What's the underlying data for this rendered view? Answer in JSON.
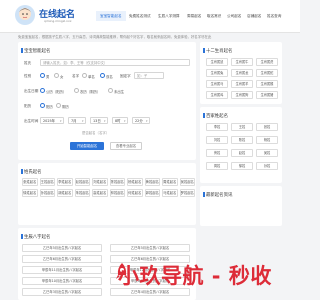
{
  "logo": {
    "title": "在线起名",
    "subtitle": "qiming.mingzi.xxx"
  },
  "nav": [
    {
      "label": "宝宝智能起名",
      "active": true
    },
    {
      "label": "免费姓名测试"
    },
    {
      "label": "生辰八字测算"
    },
    {
      "label": "周易起名"
    },
    {
      "label": "取名常识"
    },
    {
      "label": "公司起名"
    },
    {
      "label": "店铺起名"
    },
    {
      "label": "姓名查询"
    }
  ],
  "notice": "免费宝宝起名，根据孩子生辰八字、五行喜忌、诗词典故智能推荐，帮你起个好名字，取名就来起名网，免费体验，好名字尽在此",
  "form": {
    "title": "宝宝智能起名",
    "surname_label": "姓氏",
    "surname_placeholder": "请输入姓氏，如：李、王等（仅支持中文）",
    "gender_label": "性别",
    "gender_options": [
      "男",
      "女"
    ],
    "name_len_label": "名字",
    "name_len_options": [
      "单名",
      "双名"
    ],
    "fixed_char_label": "固定字",
    "fixed_char_placeholder": "如：子",
    "birth_label": "出生日期",
    "birth_options": [
      "公历（阳历）",
      "农历（阴历）",
      "未出生"
    ],
    "calendar_options": [
      "阳历",
      "阴历"
    ],
    "date_label": "出生时间",
    "year": "2025年",
    "month": "7月",
    "day": "13日",
    "hour": "8时",
    "minute": "22分",
    "hint": "是否起名（名字）",
    "submit": "开始智能起名",
    "secondary": "查看专业起名"
  },
  "right_top": {
    "title": "十二生肖起名",
    "items": [
      "生肖属鼠",
      "生肖属牛",
      "生肖属虎",
      "生肖属兔",
      "生肖属龙",
      "生肖属蛇",
      "生肖属马",
      "生肖属羊",
      "生肖属猴",
      "生肖属鸡",
      "生肖属狗",
      "生肖属猪"
    ]
  },
  "right_mid": {
    "title": "百家姓起名",
    "items": [
      "李姓",
      "王姓",
      "张姓",
      "刘姓",
      "陈姓",
      "杨姓",
      "黄姓",
      "赵姓",
      "吴姓",
      "周姓",
      "徐姓",
      "孙姓"
    ]
  },
  "right_bottom": {
    "title": "最新起名资讯"
  },
  "names_card": {
    "title": "姓氏起名",
    "tags": [
      "张姓起名",
      "王姓起名",
      "李姓起名",
      "赵姓起名",
      "刘姓起名",
      "陈姓起名",
      "杨姓起名",
      "黄姓起名",
      "周姓起名",
      "吴姓起名",
      "徐姓起名",
      "孙姓起名",
      "胡姓起名",
      "朱姓起名",
      "高姓起名",
      "林姓起名",
      "何姓起名",
      "郭姓起名",
      "马姓起名",
      "罗姓起名"
    ]
  },
  "bazi_card": {
    "title": "生辰八字起名",
    "items": [
      "乙巳年5月出生的八字起名",
      "乙巳年5月出生的八字起名",
      "乙巳年6月出生的八字起名",
      "乙巳年6月出生的八字起名",
      "甲辰年11月出生的八字起名",
      "甲辰年12月出生的八字起名",
      "甲辰年10月出生的八字起名",
      "甲辰年9月出生的八字起名",
      "乙巳年3月出生的八字起名",
      "乙巳年4月出生的八字起名"
    ]
  },
  "watermark": "小玖导航 - 秒收"
}
